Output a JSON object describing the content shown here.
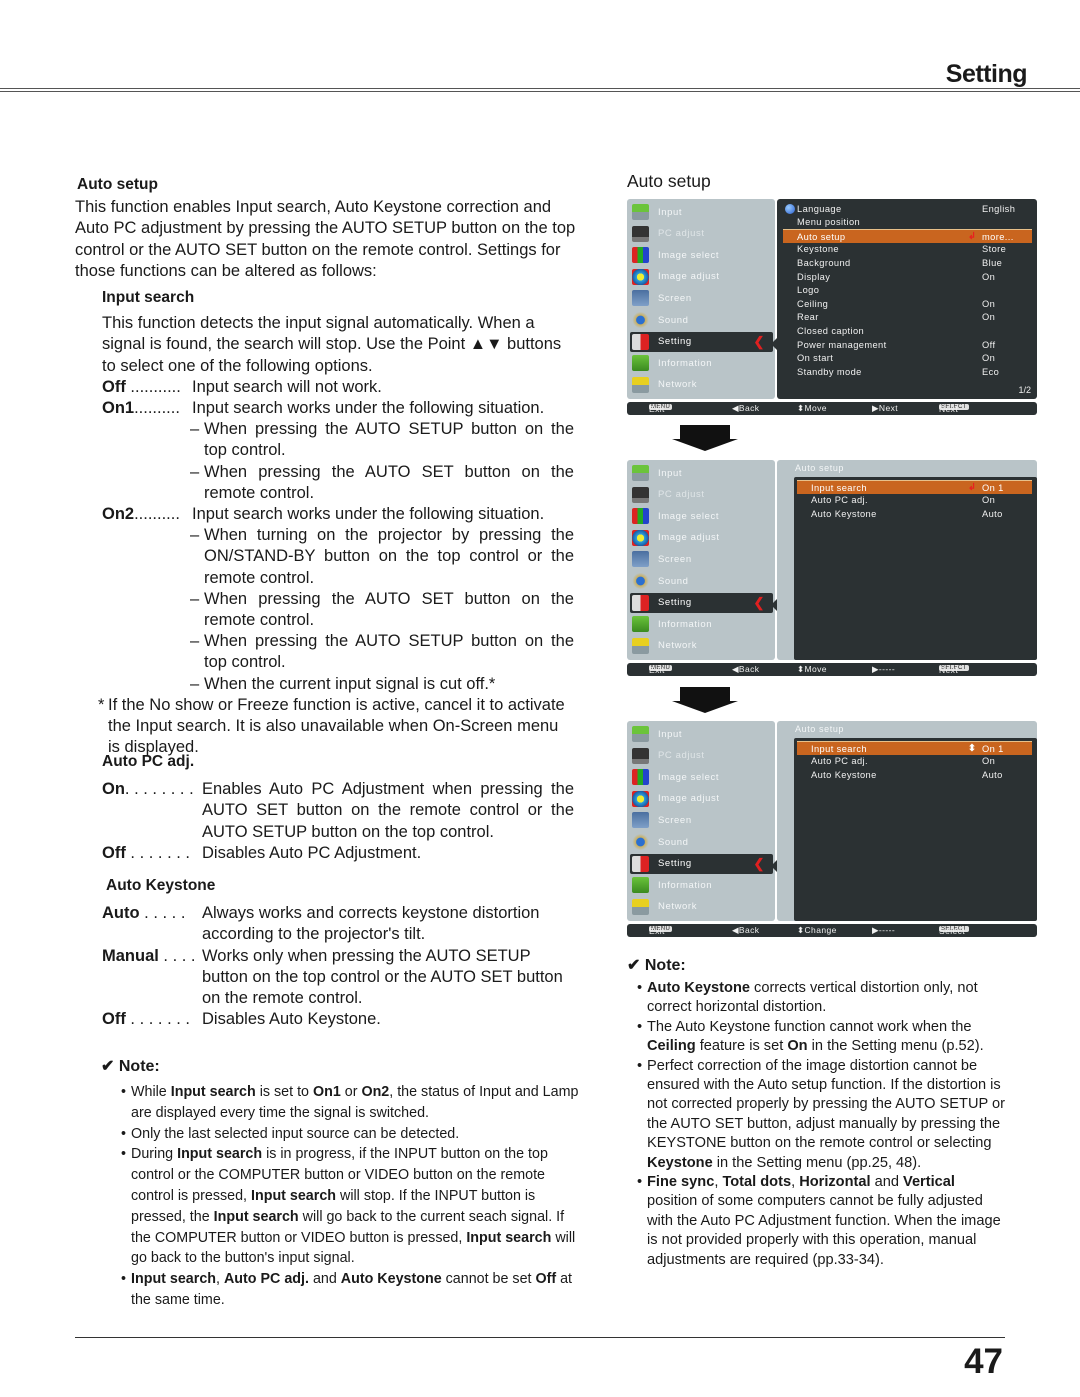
{
  "header": {
    "section_title": "Setting"
  },
  "left": {
    "auto_setup": {
      "heading": "Auto setup",
      "intro": "This function enables Input search, Auto Keystone correction and Auto PC adjustment by pressing the AUTO SETUP button on the top control or the AUTO SET button on the remote control. Settings for those functions can be altered as follows:"
    },
    "input_search": {
      "heading": "Input search",
      "intro": "This function detects the input signal automatically. When a signal is found, the search will stop. Use the Point ▲▼ buttons to select one of the following options.",
      "options": [
        {
          "term": "Off",
          "dots": " ........... ",
          "desc": "Input search will not work.",
          "sub": []
        },
        {
          "term": "On1",
          "dots": ".......... ",
          "desc": "Input search works under the following situation.",
          "sub": [
            "When pressing the AUTO SETUP button on the top control.",
            "When pressing the AUTO SET button on the remote control."
          ]
        },
        {
          "term": "On2",
          "dots": ".......... ",
          "desc": "Input search works under the following situation.",
          "sub": [
            "When turning on the projector by pressing the ON/STAND-BY button on the top control or the remote control.",
            "When pressing the AUTO SET button on the remote control.",
            "When pressing the AUTO SETUP button on the top control.",
            " When the current input signal is cut off.*"
          ]
        }
      ],
      "footnote_mark": "*",
      "footnote": "If the No show or Freeze function is active, cancel it to activate the Input search. It is also unavailable when On-Screen menu is displayed."
    },
    "auto_pc_adj": {
      "heading": "Auto PC adj.",
      "options": [
        {
          "term": "On",
          "dots": ". . . . . . . .",
          "desc": "Enables Auto PC Adjustment when pressing the AUTO SET button on the remote control or the AUTO SETUP button on the top control."
        },
        {
          "term": "Off",
          "dots": " . . . . . . .",
          "desc": "Disables Auto PC Adjustment."
        }
      ]
    },
    "auto_keystone": {
      "heading": "Auto Keystone",
      "options": [
        {
          "term": "Auto",
          "dots": " . . . . . ",
          "desc": "Always works and corrects keystone distortion according to the projector's tilt."
        },
        {
          "term": "Manual",
          "dots": " . . . .",
          "desc": "Works only when pressing the AUTO SETUP button on the top control or the AUTO SET button on the remote control."
        },
        {
          "term": "Off",
          "dots": " . . . . . . .",
          "desc": "Disables Auto Keystone."
        }
      ]
    },
    "note": {
      "icon": "✔",
      "heading": "Note:",
      "items": [
        [
          [
            "While ",
            false
          ],
          [
            "Input search",
            true
          ],
          [
            " is set to ",
            false
          ],
          [
            "On1",
            true
          ],
          [
            " or ",
            false
          ],
          [
            "On2",
            true
          ],
          [
            ", the status of Input and Lamp are displayed every time the signal is switched.",
            false
          ]
        ],
        [
          [
            "Only the last selected input source can be detected.",
            false
          ]
        ],
        [
          [
            "During ",
            false
          ],
          [
            "Input search",
            true
          ],
          [
            " is in progress, if the INPUT button on the top control or the COMPUTER button or VIDEO button on the remote control is pressed, ",
            false
          ],
          [
            "Input search",
            true
          ],
          [
            " will stop. If the INPUT button is pressed, the ",
            false
          ],
          [
            "Input search",
            true
          ],
          [
            " will go back to the current seach signal. If the COMPUTER button or VIDEO button is pressed, ",
            false
          ],
          [
            "Input search",
            true
          ],
          [
            " will go back to the button's input signal.",
            false
          ]
        ],
        [
          [
            "Input search",
            true
          ],
          [
            ", ",
            false
          ],
          [
            "Auto PC adj.",
            true
          ],
          [
            " and ",
            false
          ],
          [
            "Auto Keystone",
            true
          ],
          [
            " cannot be set ",
            false
          ],
          [
            "Off",
            true
          ],
          [
            " at the same time.",
            false
          ]
        ]
      ]
    }
  },
  "right": {
    "title": "Auto setup",
    "sidebar": [
      {
        "label": "Input",
        "icon": "input-icon",
        "dim": false
      },
      {
        "label": "PC adjust",
        "icon": "pc-adjust-icon",
        "dim": true
      },
      {
        "label": "Image select",
        "icon": "image-select-icon",
        "dim": false
      },
      {
        "label": "Image adjust",
        "icon": "image-adjust-icon",
        "dim": false
      },
      {
        "label": "Screen",
        "icon": "screen-icon",
        "dim": false
      },
      {
        "label": "Sound",
        "icon": "sound-icon",
        "dim": false
      },
      {
        "label": "Setting",
        "icon": "setting-icon",
        "dim": false
      },
      {
        "label": "Information",
        "icon": "information-icon",
        "dim": false
      },
      {
        "label": "Network",
        "icon": "network-icon",
        "dim": false
      }
    ],
    "osd1": {
      "rows": [
        {
          "label": "Language",
          "value": "English"
        },
        {
          "label": "Menu position",
          "value": ""
        },
        {
          "label": "Auto setup",
          "value": "more..."
        },
        {
          "label": "Keystone",
          "value": "Store"
        },
        {
          "label": "Background",
          "value": "Blue"
        },
        {
          "label": "Display",
          "value": "On"
        },
        {
          "label": "Logo",
          "value": ""
        },
        {
          "label": "Ceiling",
          "value": "On"
        },
        {
          "label": "Rear",
          "value": "On"
        },
        {
          "label": "Closed caption",
          "value": ""
        },
        {
          "label": "Power management",
          "value": "Off"
        },
        {
          "label": "On start",
          "value": "On"
        },
        {
          "label": "Standby mode",
          "value": "Eco"
        }
      ],
      "page": "1/2",
      "bar": {
        "menu_key": "MENU",
        "exit": "Exit",
        "back": "◀Back",
        "move": "⬍Move",
        "next": "▶Next",
        "select_key": "SELECT",
        "select": "Next"
      }
    },
    "osd2": {
      "title": "Auto setup",
      "rows": [
        {
          "label": "Input search",
          "value": "On 1"
        },
        {
          "label": "Auto PC adj.",
          "value": "On"
        },
        {
          "label": "Auto Keystone",
          "value": "Auto"
        }
      ],
      "bar": {
        "menu_key": "MENU",
        "exit": "Exit",
        "back": "◀Back",
        "move": "⬍Move",
        "next": "▶-----",
        "select_key": "SELECT",
        "select": "Next"
      }
    },
    "osd3": {
      "title": "Auto setup",
      "rows": [
        {
          "label": "Input search",
          "value": "On 1"
        },
        {
          "label": "Auto PC adj.",
          "value": "On"
        },
        {
          "label": "Auto Keystone",
          "value": "Auto"
        }
      ],
      "bar": {
        "menu_key": "MENU",
        "exit": "Exit",
        "back": "◀Back",
        "move": "⬍Change",
        "next": "▶-----",
        "select_key": "SELECT",
        "select": "Select"
      }
    },
    "note": {
      "icon": "✔",
      "heading": "Note:",
      "items": [
        [
          [
            "Auto Keystone",
            true
          ],
          [
            " corrects vertical distortion only, not correct horizontal distortion.",
            false
          ]
        ],
        [
          [
            "The Auto Keystone function cannot work when the ",
            false
          ],
          [
            "Ceiling",
            true
          ],
          [
            " feature is set ",
            false
          ],
          [
            "On",
            true
          ],
          [
            " in the Setting menu (p.52).",
            false
          ]
        ],
        [
          [
            "Perfect correction of the image distortion cannot be ensured with the Auto setup function. If the distortion is not corrected properly by pressing the AUTO SETUP or the AUTO SET button, adjust manually by pressing the KEYSTONE button on the remote control or selecting ",
            false
          ],
          [
            "Keystone",
            true
          ],
          [
            " in the Setting menu (pp.25, 48).",
            false
          ]
        ],
        [
          [
            "Fine sync",
            true
          ],
          [
            ", ",
            false
          ],
          [
            "Total dots",
            true
          ],
          [
            ", ",
            false
          ],
          [
            "Horizontal",
            true
          ],
          [
            " and ",
            false
          ],
          [
            "Vertical",
            true
          ],
          [
            " position of some computers cannot be fully adjusted with the Auto PC Adjustment function. When the image is not provided properly with this operation, manual adjustments are required (pp.33-34).",
            false
          ]
        ]
      ]
    }
  },
  "footer": {
    "page_number": "47"
  }
}
